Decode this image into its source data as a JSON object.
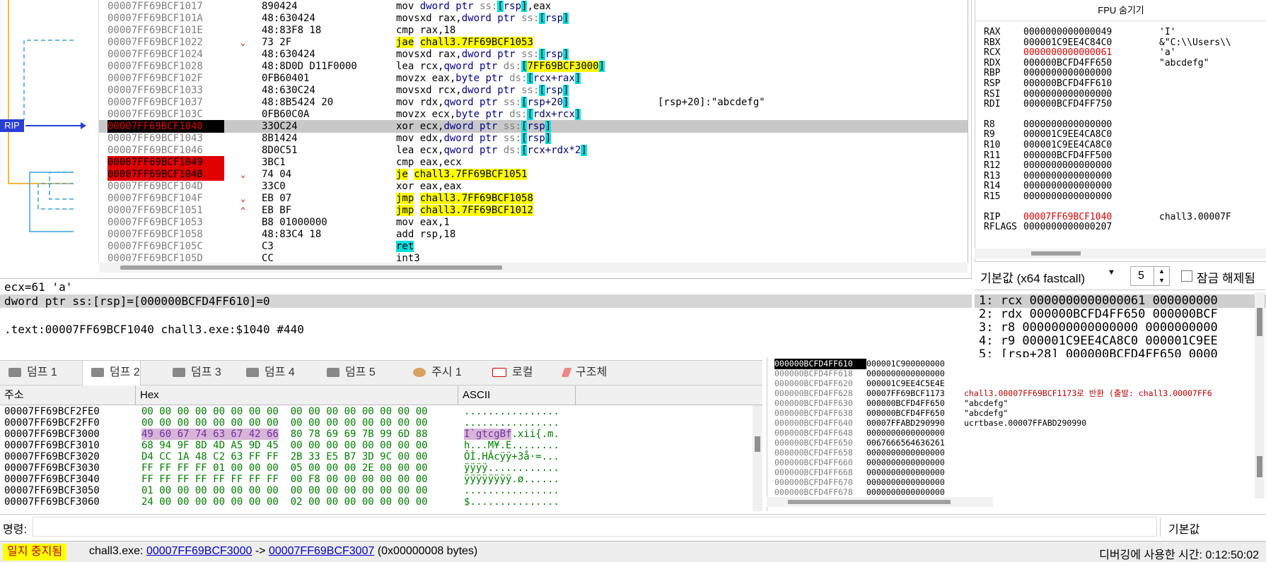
{
  "rip_label": "RIP",
  "disasm": [
    {
      "addr": "00007FF69BCF1017",
      "bytes": "890424",
      "arrow": "",
      "segs": [
        [
          "n",
          "mov "
        ],
        [
          "op",
          "dword ptr "
        ],
        [
          "seg",
          "ss:"
        ],
        [
          "brk",
          "["
        ],
        [
          "reg",
          "rsp"
        ],
        [
          "brk",
          "]"
        ],
        [
          "n",
          ",eax"
        ]
      ],
      "bp": false,
      "dot": "grey"
    },
    {
      "addr": "00007FF69BCF101A",
      "bytes": "48:630424",
      "arrow": "",
      "segs": [
        [
          "n",
          "movsxd rax,"
        ],
        [
          "op",
          "dword ptr "
        ],
        [
          "seg",
          "ss:"
        ],
        [
          "brk",
          "["
        ],
        [
          "reg",
          "rsp"
        ],
        [
          "brk",
          "]"
        ]
      ],
      "dot": "grey"
    },
    {
      "addr": "00007FF69BCF101E",
      "bytes": "48:83F8 18",
      "arrow": "",
      "segs": [
        [
          "n",
          "cmp rax,18"
        ]
      ],
      "dot": "grey"
    },
    {
      "addr": "00007FF69BCF1022",
      "bytes": "73 2F",
      "arrow": "⌄",
      "segs": [
        [
          "jmp",
          "jae"
        ],
        [
          "n",
          " "
        ],
        [
          "jmp",
          "chall3.7FF69BCF1053"
        ]
      ],
      "dot": "grey"
    },
    {
      "addr": "00007FF69BCF1024",
      "bytes": "48:630424",
      "arrow": "",
      "segs": [
        [
          "n",
          "movsxd rax,"
        ],
        [
          "op",
          "dword ptr "
        ],
        [
          "seg",
          "ss:"
        ],
        [
          "brk",
          "["
        ],
        [
          "reg",
          "rsp"
        ],
        [
          "brk",
          "]"
        ]
      ],
      "dot": "grey"
    },
    {
      "addr": "00007FF69BCF1028",
      "bytes": "48:8D0D D11F0000",
      "arrow": "",
      "segs": [
        [
          "n",
          "lea rcx,"
        ],
        [
          "op",
          "qword ptr "
        ],
        [
          "seg",
          "ds:"
        ],
        [
          "brk",
          "["
        ],
        [
          "jmp",
          "7FF69BCF3000"
        ],
        [
          "brk",
          "]"
        ]
      ],
      "dot": "grey"
    },
    {
      "addr": "00007FF69BCF102F",
      "bytes": "0FB60401",
      "arrow": "",
      "segs": [
        [
          "n",
          "movzx eax,"
        ],
        [
          "op",
          "byte ptr "
        ],
        [
          "seg",
          "ds:"
        ],
        [
          "brk",
          "["
        ],
        [
          "reg",
          "rcx+rax"
        ],
        [
          "brk",
          "]"
        ]
      ],
      "dot": "grey"
    },
    {
      "addr": "00007FF69BCF1033",
      "bytes": "48:630C24",
      "arrow": "",
      "segs": [
        [
          "n",
          "movsxd rcx,"
        ],
        [
          "op",
          "dword ptr "
        ],
        [
          "seg",
          "ss:"
        ],
        [
          "brk",
          "["
        ],
        [
          "reg",
          "rsp"
        ],
        [
          "brk",
          "]"
        ]
      ],
      "dot": "grey"
    },
    {
      "addr": "00007FF69BCF1037",
      "bytes": "48:8B5424 20",
      "arrow": "",
      "segs": [
        [
          "n",
          "mov rdx,"
        ],
        [
          "op",
          "qword ptr "
        ],
        [
          "seg",
          "ss:"
        ],
        [
          "brk",
          "["
        ],
        [
          "reg",
          "rsp+20"
        ],
        [
          "brk",
          "]"
        ]
      ],
      "cmt": "[rsp+20]:\"abcdefg\"",
      "dot": "grey"
    },
    {
      "addr": "00007FF69BCF103C",
      "bytes": "0FB60C0A",
      "arrow": "",
      "segs": [
        [
          "n",
          "movzx ecx,"
        ],
        [
          "op",
          "byte ptr "
        ],
        [
          "seg",
          "ds:"
        ],
        [
          "brk",
          "["
        ],
        [
          "reg",
          "rdx+rcx"
        ],
        [
          "brk",
          "]"
        ]
      ],
      "dot": "grey"
    },
    {
      "addr": "00007FF69BCF1040",
      "bytes": "33OC24",
      "arrow": "",
      "segs": [
        [
          "n",
          "xor ecx,"
        ],
        [
          "op",
          "dword ptr "
        ],
        [
          "seg",
          "ss:"
        ],
        [
          "brk",
          "["
        ],
        [
          "reg",
          "rsp"
        ],
        [
          "brk",
          "]"
        ]
      ],
      "dot": "red",
      "cur": true
    },
    {
      "addr": "00007FF69BCF1043",
      "bytes": "8B1424",
      "arrow": "",
      "segs": [
        [
          "n",
          "mov edx,"
        ],
        [
          "op",
          "dword ptr "
        ],
        [
          "seg",
          "ss:"
        ],
        [
          "brk",
          "["
        ],
        [
          "reg",
          "rsp"
        ],
        [
          "brk",
          "]"
        ]
      ],
      "dot": "grey"
    },
    {
      "addr": "00007FF69BCF1046",
      "bytes": "8D0C51",
      "arrow": "",
      "segs": [
        [
          "n",
          "lea ecx,"
        ],
        [
          "op",
          "qword ptr "
        ],
        [
          "seg",
          "ds:"
        ],
        [
          "brk",
          "["
        ],
        [
          "reg",
          "rcx+rdx*2"
        ],
        [
          "brk",
          "]"
        ]
      ],
      "dot": "grey"
    },
    {
      "addr": "00007FF69BCF1049",
      "bytes": "3BC1",
      "arrow": "",
      "segs": [
        [
          "n",
          "cmp eax,ecx"
        ]
      ],
      "dot": "red",
      "bp": true
    },
    {
      "addr": "00007FF69BCF104B",
      "bytes": "74 04",
      "arrow": "⌄",
      "segs": [
        [
          "jmp",
          "je"
        ],
        [
          "n",
          " "
        ],
        [
          "jmp",
          "chall3.7FF69BCF1051"
        ]
      ],
      "dot": "red",
      "bp": true
    },
    {
      "addr": "00007FF69BCF104D",
      "bytes": "33C0",
      "arrow": "",
      "segs": [
        [
          "n",
          "xor eax,eax"
        ]
      ],
      "dot": "grey"
    },
    {
      "addr": "00007FF69BCF104F",
      "bytes": "EB 07",
      "arrow": "⌄",
      "segs": [
        [
          "jmp",
          "jmp"
        ],
        [
          "n",
          " "
        ],
        [
          "jmp",
          "chall3.7FF69BCF1058"
        ]
      ],
      "dot": "grey"
    },
    {
      "addr": "00007FF69BCF1051",
      "bytes": "EB BF",
      "arrow": "⌃",
      "segs": [
        [
          "jmp",
          "jmp"
        ],
        [
          "n",
          " "
        ],
        [
          "jmp",
          "chall3.7FF69BCF1012"
        ]
      ],
      "dot": "grey"
    },
    {
      "addr": "00007FF69BCF1053",
      "bytes": "B8 01000000",
      "arrow": "",
      "segs": [
        [
          "n",
          "mov eax,1"
        ]
      ],
      "dot": "grey"
    },
    {
      "addr": "00007FF69BCF1058",
      "bytes": "48:83C4 18",
      "arrow": "",
      "segs": [
        [
          "n",
          "add rsp,18"
        ]
      ],
      "dot": "grey"
    },
    {
      "addr": "00007FF69BCF105C",
      "bytes": "C3",
      "arrow": "",
      "segs": [
        [
          "brk",
          "ret"
        ]
      ],
      "dot": "grey"
    },
    {
      "addr": "00007FF69BCF105D",
      "bytes": "CC",
      "arrow": "",
      "segs": [
        [
          "n",
          "int3"
        ]
      ],
      "dot": "grey"
    }
  ],
  "info": {
    "line1": "ecx=61 'a'",
    "line2": "dword ptr ss:[rsp]=[000000BCFD4FF610]=0",
    "line3": ".text:00007FF69BCF1040 chall3.exe:$1040 #440"
  },
  "registers": {
    "title": "FPU 숨기기",
    "rows": [
      {
        "n": "RAX",
        "v": "0000000000000049",
        "c": "'I'"
      },
      {
        "n": "RBX",
        "v": "000001C9EE4C84C0",
        "c": "&\"C:\\\\Users\\\\"
      },
      {
        "n": "RCX",
        "v": "0000000000000061",
        "c": "'a'",
        "chg": true
      },
      {
        "n": "RDX",
        "v": "000000BCFD4FF650",
        "c": "\"abcdefg\""
      },
      {
        "n": "RBP",
        "v": "0000000000000000",
        "c": ""
      },
      {
        "n": "RSP",
        "v": "000000BCFD4FF610",
        "c": ""
      },
      {
        "n": "RSI",
        "v": "0000000000000000",
        "c": ""
      },
      {
        "n": "RDI",
        "v": "000000BCFD4FF750",
        "c": ""
      },
      {
        "n": "R8",
        "v": "0000000000000000",
        "c": ""
      },
      {
        "n": "R9",
        "v": "000001C9EE4CA8C0",
        "c": ""
      },
      {
        "n": "R10",
        "v": "000001C9EE4CA8C0",
        "c": ""
      },
      {
        "n": "R11",
        "v": "000000BCFD4FF500",
        "c": ""
      },
      {
        "n": "R12",
        "v": "0000000000000000",
        "c": ""
      },
      {
        "n": "R13",
        "v": "0000000000000000",
        "c": ""
      },
      {
        "n": "R14",
        "v": "0000000000000000",
        "c": ""
      },
      {
        "n": "R15",
        "v": "0000000000000000",
        "c": ""
      },
      {
        "n": "RIP",
        "v": "00007FF69BCF1040",
        "c": "chall3.00007F",
        "chg": true
      },
      {
        "n": "RFLAGS",
        "v": "0000000000000207",
        "c": ""
      }
    ]
  },
  "callconv": {
    "label": "기본값 (x64 fastcall)",
    "count": "5",
    "lock_label": "잠금 해제됨"
  },
  "args": [
    "1: rcx 0000000000000061 000000000",
    "2: rdx 000000BCFD4FF650 000000BCF",
    "3: r8 0000000000000000 0000000000",
    "4: r9 000001C9EE4CA8C0 000001C9EE",
    "5: [rsp+28] 000000BCFD4FF650 0000"
  ],
  "tabs": [
    {
      "label": "덤프 1",
      "icon": "dump-icon"
    },
    {
      "label": "덤프 2",
      "icon": "dump-icon"
    },
    {
      "label": "덤프 3",
      "icon": "dump-icon"
    },
    {
      "label": "덤프 4",
      "icon": "dump-icon"
    },
    {
      "label": "덤프 5",
      "icon": "dump-icon"
    },
    {
      "label": "주시 1",
      "icon": "watch-icon"
    },
    {
      "label": "로컬",
      "icon": "local-icon"
    },
    {
      "label": "구조체",
      "icon": "struct-icon"
    }
  ],
  "dump": {
    "headers": {
      "addr": "주소",
      "hex": "Hex",
      "ascii": "ASCII"
    },
    "rows": [
      {
        "a": "00007FF69BCF2FE0",
        "h": "00 00 00 00 00 00 00 00  00 00 00 00 00 00 00 00",
        "s": "................"
      },
      {
        "a": "00007FF69BCF2FF0",
        "h": "00 00 00 00 00 00 00 00  00 00 00 00 00 00 00 00",
        "s": "................"
      },
      {
        "a": "00007FF69BCF3000",
        "h": "49 60 67 74 63 67 42 66  80 78 69 69 7B 99 6D 88",
        "s": "I`gtcgBf.xii{.m.",
        "hl": true
      },
      {
        "a": "00007FF69BCF3010",
        "h": "68 94 9F 8D 4D A5 9D 45  00 00 00 00 00 00 00 00",
        "s": "h...M¥.E........"
      },
      {
        "a": "00007FF69BCF3020",
        "h": "D4 CC 1A 48 C2 63 FF FF  2B 33 E5 B7 3D 9C 00 00",
        "s": "ÔÌ.HÂcÿÿ+3å·=..."
      },
      {
        "a": "00007FF69BCF3030",
        "h": "FF FF FF FF 01 00 00 00  05 00 00 00 2E 00 00 00",
        "s": "ÿÿÿÿ............"
      },
      {
        "a": "00007FF69BCF3040",
        "h": "FF FF FF FF FF FF FF FF  00 F8 00 00 00 00 00 00",
        "s": "ÿÿÿÿÿÿÿÿ.ø......"
      },
      {
        "a": "00007FF69BCF3050",
        "h": "01 00 00 00 00 00 00 00  00 00 00 00 00 00 00 00",
        "s": "................"
      },
      {
        "a": "00007FF69BCF3060",
        "h": "24 00 00 00 00 00 00 00  02 00 00 00 00 00 00 00",
        "s": "$..............."
      }
    ]
  },
  "stack": [
    {
      "a": "000000BCFD4FF610",
      "v": "000001C900000000",
      "c": "",
      "top": true
    },
    {
      "a": "000000BCFD4FF618",
      "v": "0000000000000000",
      "c": ""
    },
    {
      "a": "000000BCFD4FF620",
      "v": "000001C9EE4C5E4E",
      "c": ""
    },
    {
      "a": "000000BCFD4FF628",
      "v": "00007FF69BCF1173",
      "c": "chall3.00007FF69BCF1173로 반환 (출발: chall3.00007FF6",
      "ret": true
    },
    {
      "a": "000000BCFD4FF630",
      "v": "000000BCFD4FF650",
      "c": "\"abcdefg\""
    },
    {
      "a": "000000BCFD4FF638",
      "v": "000000BCFD4FF650",
      "c": "\"abcdefg\""
    },
    {
      "a": "000000BCFD4FF640",
      "v": "00007FFABD290990",
      "c": "ucrtbase.00007FFABD290990"
    },
    {
      "a": "000000BCFD4FF648",
      "v": "0000000000000000",
      "c": ""
    },
    {
      "a": "000000BCFD4FF650",
      "v": "0067666564636261",
      "c": ""
    },
    {
      "a": "000000BCFD4FF658",
      "v": "0000000000000000",
      "c": ""
    },
    {
      "a": "000000BCFD4FF660",
      "v": "0000000000000000",
      "c": ""
    },
    {
      "a": "000000BCFD4FF668",
      "v": "0000000000000000",
      "c": ""
    },
    {
      "a": "000000BCFD4FF670",
      "v": "0000000000000000",
      "c": ""
    },
    {
      "a": "000000BCFD4FF678",
      "v": "0000000000000000",
      "c": ""
    }
  ],
  "cmd": {
    "label": "명령:",
    "mode": "기본값"
  },
  "status": {
    "paused": "일지 중지됨",
    "prefix": "chall3.exe: ",
    "from": "00007FF69BCF3000",
    "arrow": " -> ",
    "to": "00007FF69BCF3007",
    "suffix": " (0x00000008 bytes)",
    "timer": "디버깅에 사용한 시간: 0:12:50:02"
  },
  "colors": {
    "accent": "#2a3fd6",
    "breakpoint": "#e00000",
    "highlight": "#ffff00",
    "bracket": "#00e0e0"
  }
}
